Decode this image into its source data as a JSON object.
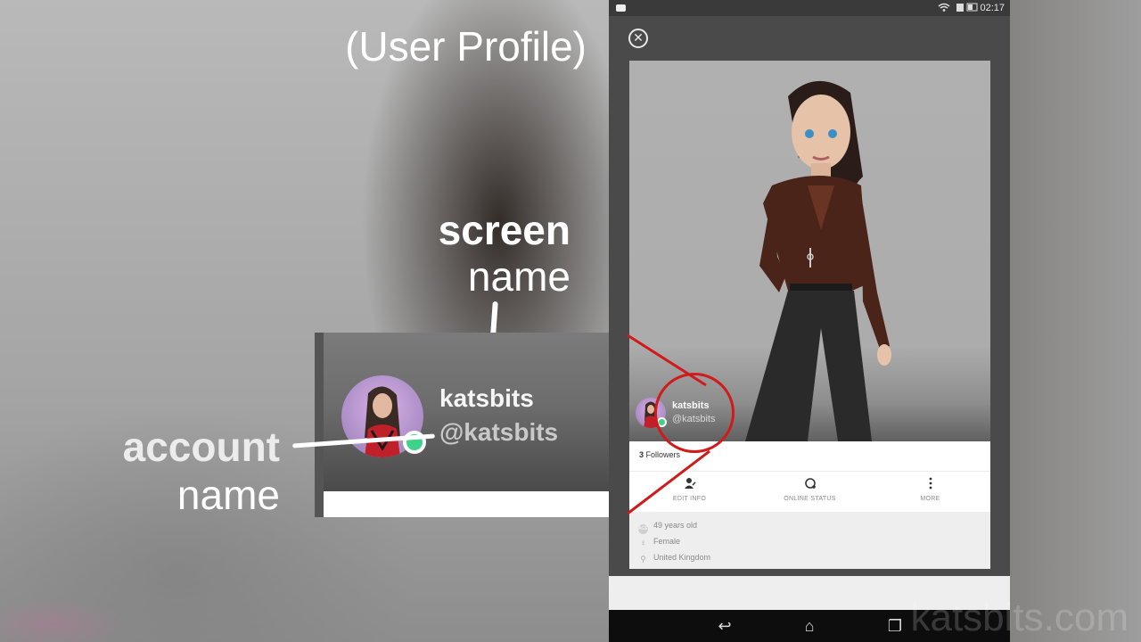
{
  "annotations": {
    "title": "(User Profile)",
    "screen_label_bold": "screen",
    "screen_label_rest": "name",
    "account_label_bold": "account",
    "account_label_rest": "name"
  },
  "zoom": {
    "screen_name": "katsbits",
    "account_name": "@katsbits"
  },
  "phone": {
    "status_time": "02:17",
    "status_icons": "wifi-icon battery-icon",
    "close_icon": "close-circle-icon",
    "profile": {
      "screen_name": "katsbits",
      "account_name": "@katsbits",
      "followers_count": "3",
      "followers_label": "Followers"
    },
    "actions": [
      {
        "label": "EDIT INFO",
        "icon": "edit-person-icon"
      },
      {
        "label": "ONLINE STATUS",
        "icon": "status-refresh-icon"
      },
      {
        "label": "MORE",
        "icon": "more-vertical-icon"
      }
    ],
    "info": [
      {
        "text": "49 years old",
        "icon": "age-icon"
      },
      {
        "text": "Female",
        "icon": "gender-icon"
      },
      {
        "text": "United Kingdom",
        "icon": "location-icon"
      }
    ],
    "nav": [
      "back-icon",
      "home-icon",
      "recent-apps-icon"
    ]
  },
  "watermark": "katsbits.com",
  "colors": {
    "highlight_red": "#d11a1a",
    "online_green": "#3fd28a"
  }
}
